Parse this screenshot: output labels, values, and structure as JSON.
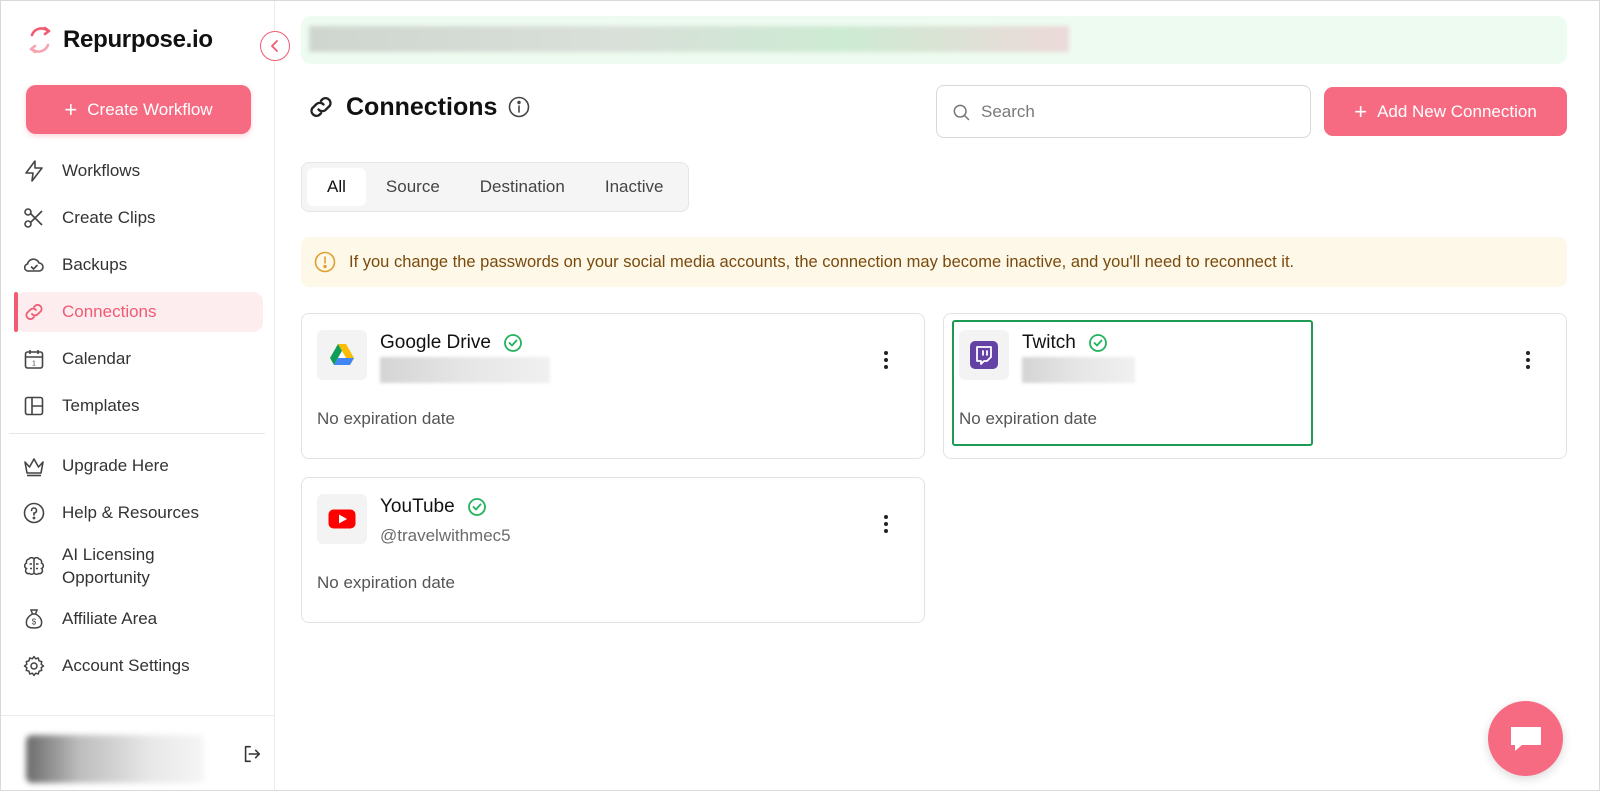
{
  "app": {
    "name": "Repurpose.io"
  },
  "sidebar": {
    "create_label": "Create Workflow",
    "items": [
      {
        "label": "Workflows",
        "icon": "bolt-icon"
      },
      {
        "label": "Create Clips",
        "icon": "scissors-icon"
      },
      {
        "label": "Backups",
        "icon": "cloud-icon"
      },
      {
        "label": "Connections",
        "icon": "link-icon",
        "active": true
      },
      {
        "label": "Calendar",
        "icon": "calendar-icon"
      },
      {
        "label": "Templates",
        "icon": "layout-icon"
      }
    ],
    "secondary": [
      {
        "label": "Upgrade Here",
        "icon": "crown-icon"
      },
      {
        "label": "Help & Resources",
        "icon": "help-circle-icon"
      },
      {
        "label": "AI Licensing\nOpportunity",
        "line1": "AI Licensing",
        "line2": "Opportunity",
        "icon": "brain-icon"
      },
      {
        "label": "Affiliate Area",
        "icon": "money-bag-icon"
      },
      {
        "label": "Account Settings",
        "icon": "gear-icon"
      }
    ]
  },
  "header": {
    "title": "Connections",
    "search_placeholder": "Search",
    "add_label": "Add New Connection"
  },
  "tabs": [
    {
      "label": "All",
      "active": true
    },
    {
      "label": "Source"
    },
    {
      "label": "Destination"
    },
    {
      "label": "Inactive"
    }
  ],
  "notice": "If you change the passwords on your social media accounts, the connection may become inactive, and you'll need to reconnect it.",
  "connections": [
    {
      "name": "Google Drive",
      "handle": "",
      "expiry": "No expiration date",
      "icon": "google-drive-icon",
      "status": "connected"
    },
    {
      "name": "Twitch",
      "handle": "",
      "expiry": "No expiration date",
      "icon": "twitch-icon",
      "status": "connected"
    },
    {
      "name": "YouTube",
      "handle": "@travelwithmec5",
      "expiry": "No expiration date",
      "icon": "youtube-icon",
      "status": "connected"
    }
  ],
  "colors": {
    "accent": "#f76b82",
    "success": "#22b35e",
    "highlight": "#1e9a54",
    "notice_bg": "#fdf8e8"
  }
}
